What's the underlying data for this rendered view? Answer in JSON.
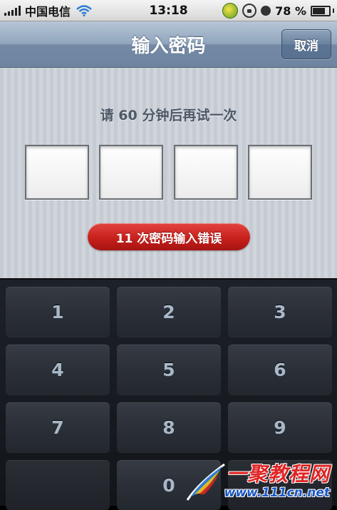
{
  "status_bar": {
    "carrier": "中国电信",
    "time": "13:18",
    "battery_label": "78 %",
    "battery_level": 0.78,
    "signal_bars": 5
  },
  "nav_bar": {
    "title": "输入密码",
    "cancel_label": "取消"
  },
  "passcode": {
    "hint": "请 60 分钟后再试一次",
    "box_count": 4,
    "error_badge": "11 次密码输入错误"
  },
  "keypad": {
    "keys": [
      "1",
      "2",
      "3",
      "4",
      "5",
      "6",
      "7",
      "8",
      "9",
      "",
      "0",
      ""
    ]
  },
  "watermark": {
    "line1": "一聚教程网",
    "line2": "www.111cn.net"
  },
  "colors": {
    "nav_blue": "#7389a5",
    "error_red": "#c8201c",
    "keypad_dark": "#1d2128",
    "key_text": "#a9b8c8",
    "watermark_red": "#e02424",
    "watermark_blue": "#1a58c7"
  },
  "icons": {
    "signal": "signal-bars-icon",
    "wifi": "wifi-icon",
    "sync": "sync-app-icon",
    "rotation_lock": "rotation-lock-icon",
    "alarm": "clock-icon",
    "battery": "battery-icon"
  }
}
